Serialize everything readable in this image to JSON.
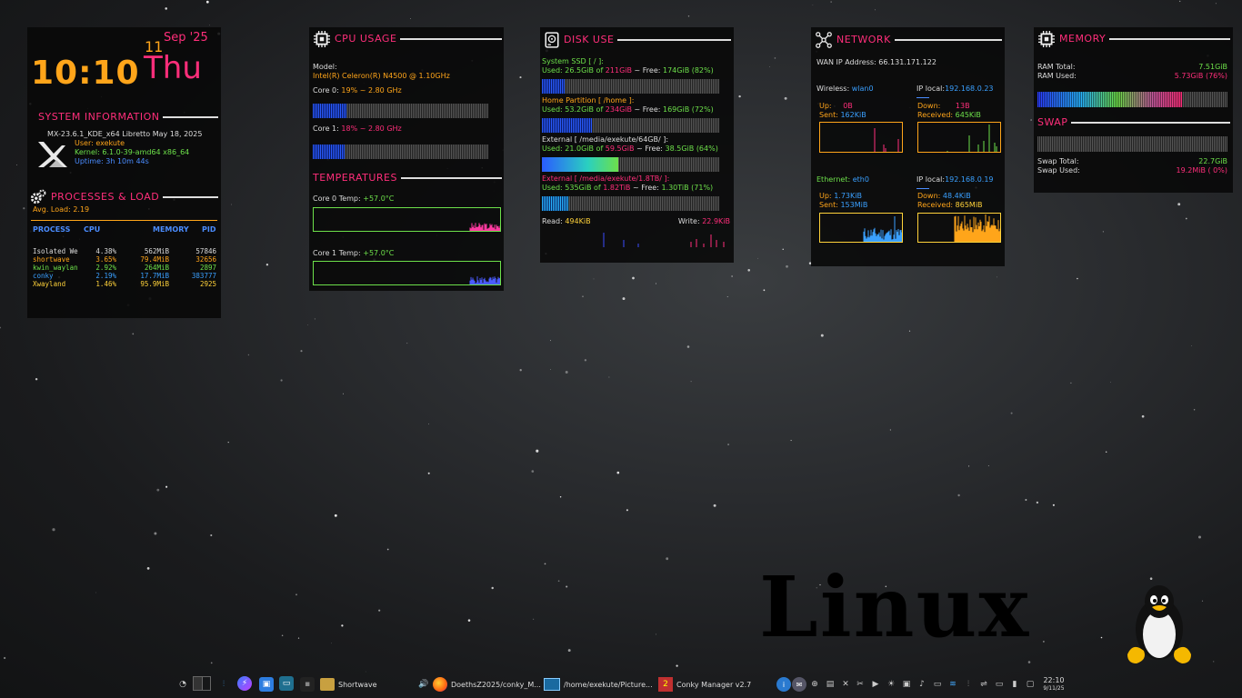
{
  "clock": {
    "time": "10:10",
    "day_number": "11",
    "month_year": "Sep '25",
    "weekday": "Thu"
  },
  "sysinfo": {
    "title": "SYSTEM INFORMATION",
    "distro": "MX-23.6.1_KDE_x64 Libretto May 18, 2025",
    "user": "User: exekute",
    "kernel": "Kernel: 6.1.0-39-amd64 x86_64",
    "uptime": "Uptime: 3h 10m 44s"
  },
  "processes": {
    "title": "PROCESSES & LOAD",
    "avg_load": "Avg. Load: 2.19",
    "headers": [
      "PROCESS",
      "CPU",
      "MEMORY",
      "PID"
    ],
    "rows": [
      {
        "name": "Isolated We",
        "cpu": "4.38%",
        "mem": "562MiB",
        "pid": "57846",
        "color": "#dcdcdc"
      },
      {
        "name": "shortwave",
        "cpu": "3.65%",
        "mem": "79.4MiB",
        "pid": "32656",
        "color": "#ffa51a"
      },
      {
        "name": "kwin_waylan",
        "cpu": "2.92%",
        "mem": "264MiB",
        "pid": "2897",
        "color": "#6de04a"
      },
      {
        "name": "conky",
        "cpu": "2.19%",
        "mem": "17.7MiB",
        "pid": "383777",
        "color": "#3aa0ff"
      },
      {
        "name": "Xwayland",
        "cpu": "1.46%",
        "mem": "95.9MiB",
        "pid": "2925",
        "color": "#ffd23a"
      }
    ]
  },
  "cpu": {
    "title": "CPU USAGE",
    "model_label": "Model:",
    "model": "Intel(R) Celeron(R) N4500 @ 1.10GHz",
    "core0_label": "Core 0:",
    "core0_value": "19% ~ 2.80 GHz",
    "core0_pct": 19,
    "core1_label": "Core 1:",
    "core1_value": "18% ~ 2.80 GHz",
    "core1_pct": 18,
    "temps_title": "TEMPERATURES",
    "temp0_label": "Core 0 Temp:",
    "temp0_value": "+57.0°C",
    "temp1_label": "Core 1 Temp:",
    "temp1_value": "+57.0°C"
  },
  "disk": {
    "title": "DISK USE",
    "disks": [
      {
        "name": "System SSD [ / ]:",
        "name_color": "#6de04a",
        "used": "26.5GiB",
        "total": "211GiB",
        "free": "174GiB (82%)",
        "pct": 13,
        "fill": "fill-blue"
      },
      {
        "name": "Home Partition [ /home ]:",
        "name_color": "#ffa51a",
        "used": "53.2GiB",
        "total": "234GiB",
        "free": "169GiB (72%)",
        "pct": 28,
        "fill": "fill-blue"
      },
      {
        "name": "External [ /media/exekute/64GB/ ]:",
        "name_color": "#dcdcdc",
        "used": "21.0GiB",
        "total": "59.5GiB",
        "free": "38.5GiB (64%)",
        "pct": 43,
        "fill": "fill-green"
      },
      {
        "name": "External [ /media/exekute/1.8TB/ ]:",
        "name_color": "#ff2e7a",
        "used": "535GiB",
        "total": "1.82TiB",
        "free": "1.30TiB (71%)",
        "pct": 15,
        "fill": "fill-cyan"
      }
    ],
    "used_label": "Used:",
    "of_label": "of",
    "free_label": "~ Free:",
    "read_label": "Read:",
    "read_value": "494KiB",
    "write_label": "Write:",
    "write_value": "22.9KiB"
  },
  "network": {
    "title": "NETWORK",
    "wan": "WAN IP Address: 66.131.171.122",
    "wireless_label": "Wireless:",
    "wireless_iface": "wlan0",
    "wireless_ip_label": "IP local:",
    "wireless_ip": "192.168.0.23",
    "w_up_label": "Up:",
    "w_up": "0B",
    "w_sent_label": "Sent:",
    "w_sent": "162KiB",
    "w_down_label": "Down:",
    "w_down": "13B",
    "w_recv_label": "Received:",
    "w_recv": "645KiB",
    "eth_label": "Ethernet:",
    "eth_iface": "eth0",
    "eth_ip_label": "IP local:",
    "eth_ip": "192.168.0.19",
    "e_up_label": "Up:",
    "e_up": "1.73KiB",
    "e_sent_label": "Sent:",
    "e_sent": "153MiB",
    "e_down_label": "Down:",
    "e_down": "48.4KiB",
    "e_recv_label": "Received:",
    "e_recv": "865MiB"
  },
  "memory": {
    "title": "MEMORY",
    "ram_total_label": "RAM Total:",
    "ram_total": "7.51GiB",
    "ram_used_label": "RAM Used:",
    "ram_used": "5.73GiB",
    "ram_used_pct": "(76%)",
    "ram_pct": 76,
    "swap_title": "SWAP",
    "swap_total_label": "Swap Total:",
    "swap_total": "22.7GiB",
    "swap_used_label": "Swap Used:",
    "swap_used": "19.2MiB",
    "swap_used_pct": "( 0%)"
  },
  "wallpaper": {
    "text": "Linux"
  },
  "taskbar": {
    "tasks": [
      {
        "label": "Shortwave"
      },
      {
        "label": "DoethsZ2025/conky_M..."
      },
      {
        "label": "/home/exekute/Picture..."
      },
      {
        "label": "Conky Manager v2.7"
      }
    ],
    "time": "22:10",
    "date": "9/11/25"
  },
  "colors": {
    "accent_pink": "#ff2e7a",
    "accent_orange": "#ffa51a",
    "accent_green": "#6de04a",
    "accent_blue": "#4a8cff"
  }
}
